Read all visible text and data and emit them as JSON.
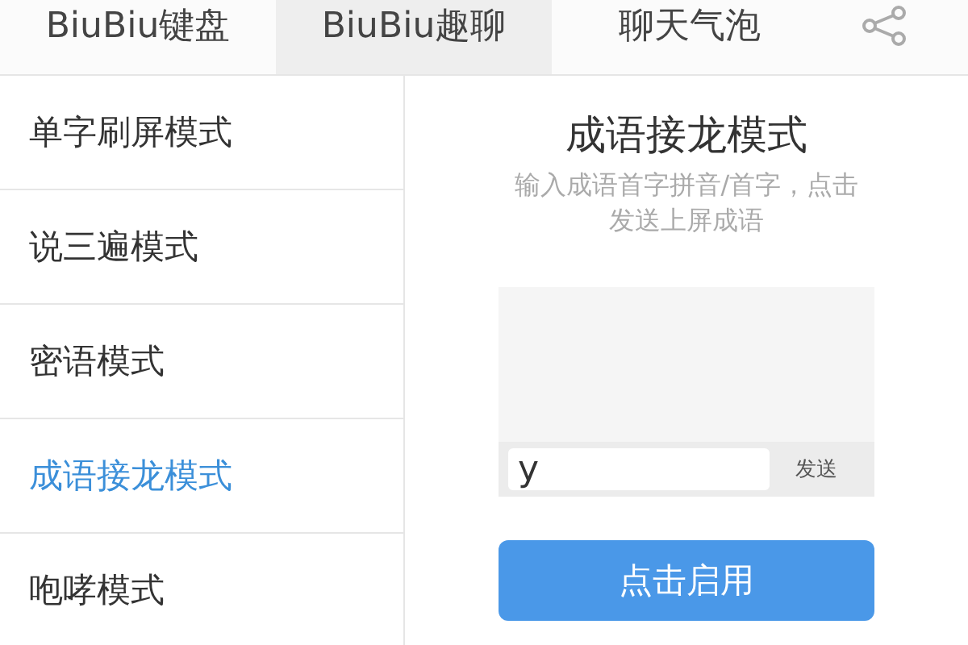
{
  "tabs": [
    {
      "label": "BiuBiu键盘",
      "selected": false
    },
    {
      "label": "BiuBiu趣聊",
      "selected": true
    },
    {
      "label": "聊天气泡",
      "selected": false
    }
  ],
  "sidebar": {
    "items": [
      {
        "label": "单字刷屏模式",
        "selected": false
      },
      {
        "label": "说三遍模式",
        "selected": false
      },
      {
        "label": "密语模式",
        "selected": false
      },
      {
        "label": "成语接龙模式",
        "selected": true
      },
      {
        "label": "咆哮模式",
        "selected": false
      }
    ]
  },
  "detail": {
    "title": "成语接龙模式",
    "description": "输入成语首字拼音/首字，点击发送上屏成语",
    "input": {
      "value": "y"
    },
    "send_label": "发送",
    "enable_label": "点击启用"
  }
}
